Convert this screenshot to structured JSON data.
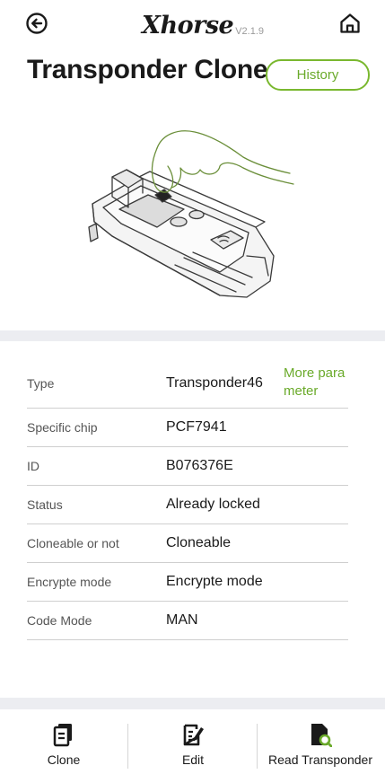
{
  "header": {
    "logo_text": "Xhorse",
    "version": "V2.1.9",
    "back_icon": "back-arrow-circle-icon",
    "home_icon": "home-icon"
  },
  "page": {
    "title": "Transponder Clone",
    "history_label": "History"
  },
  "illustration": {
    "icon": "hand-pressing-key-tool-illustration"
  },
  "info": {
    "more_link": "More parameter",
    "rows": [
      {
        "label": "Type",
        "value": "Transponder46"
      },
      {
        "label": "Specific chip",
        "value": "PCF7941"
      },
      {
        "label": "ID",
        "value": "B076376E"
      },
      {
        "label": "Status",
        "value": "Already locked"
      },
      {
        "label": "Cloneable or not",
        "value": "Cloneable"
      },
      {
        "label": "Encrypte mode",
        "value": "Encrypte mode"
      },
      {
        "label": "Code Mode",
        "value": "MAN"
      }
    ]
  },
  "bottom_nav": [
    {
      "label": "Clone",
      "icon": "clone-icon"
    },
    {
      "label": "Edit",
      "icon": "edit-icon"
    },
    {
      "label": "Read Transponder",
      "icon": "read-transponder-icon"
    }
  ],
  "colors": {
    "accent_green": "#6aaa2a",
    "band_gray": "#ecedf1",
    "text_dark": "#1a1a1a"
  }
}
